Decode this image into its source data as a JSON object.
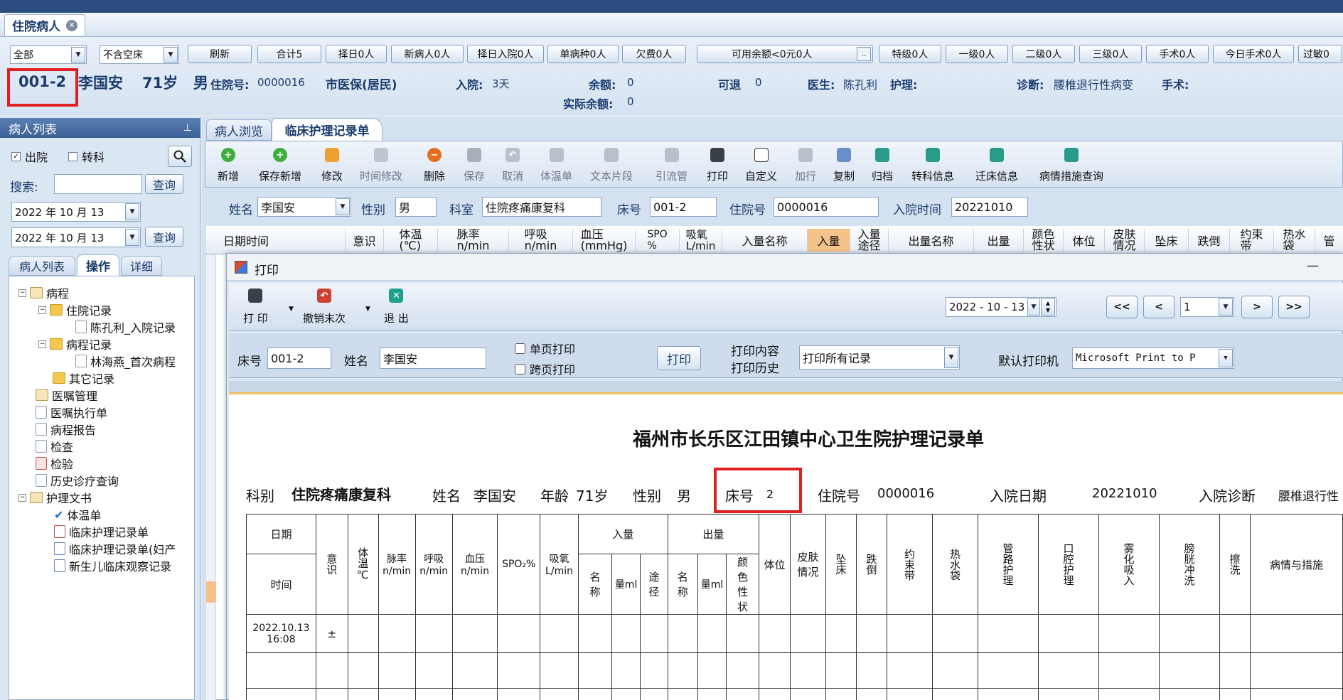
{
  "top_tab": {
    "label": "住院病人"
  },
  "filters": {
    "ward": "全部",
    "bed_filter": "不含空床"
  },
  "top_buttons": [
    "刷新",
    "合计5",
    "择日0人",
    "新病人0人",
    "择日入院0人",
    "单病种0人",
    "欠费0人",
    "可用余额<0元0人",
    "特级0人",
    "一级0人",
    "二级0人",
    "三级0人",
    "手术0人",
    "今日手术0人",
    "过敏0"
  ],
  "patient_bar": {
    "bed": "001-2",
    "name": "李国安",
    "age": "71岁",
    "sex": "男",
    "inpatient_label": "住院号:",
    "inpatient_no": "0000016",
    "insurance": "市医保(居民)",
    "admit_label": "入院:",
    "admit_days": "3天",
    "balance_label": "余额:",
    "balance": "0",
    "actual_balance_label": "实际余额:",
    "actual_balance": "0",
    "refund_label": "可退",
    "refund": "0",
    "doctor_label": "医生:",
    "doctor": "陈孔利",
    "nurse_label": "护理:",
    "diagnosis_label": "诊断:",
    "diagnosis": "腰椎退行性病变",
    "surgery_label": "手术:"
  },
  "left_panel": {
    "title": "病人列表",
    "discharged": "出院",
    "transfer": "转科",
    "search_label": "搜索:",
    "query": "查询",
    "date1": "2022 年 10 月 13",
    "date2": "2022 年 10 月 13",
    "tabs": [
      "病人列表",
      "操作",
      "详细"
    ],
    "tree": [
      "病程",
      "住院记录",
      "陈孔利_入院记录",
      "病程记录",
      "林海燕_首次病程",
      "其它记录",
      "医嘱管理",
      "医嘱执行单",
      "病程报告",
      "检查",
      "检验",
      "历史诊疗查询",
      "护理文书",
      "体温单",
      "临床护理记录单",
      "临床护理记录单(妇产",
      "新生儿临床观察记录"
    ]
  },
  "main_tabs": [
    "病人浏览",
    "临床护理记录单"
  ],
  "toolbar": [
    "新增",
    "保存新增",
    "修改",
    "时间修改",
    "删除",
    "保存",
    "取消",
    "体温单",
    "文本片段",
    "引流管",
    "打印",
    "自定义",
    "加行",
    "复制",
    "归档",
    "转科信息",
    "迁床信息",
    "病情措施查询"
  ],
  "form": {
    "name_label": "姓名",
    "name": "李国安",
    "sex_label": "性别",
    "sex": "男",
    "dept_label": "科室",
    "dept": "住院疼痛康复科",
    "bed_label": "床号",
    "bed": "001-2",
    "no_label": "住院号",
    "no": "0000016",
    "admit_label": "入院时间",
    "admit": "20221010"
  },
  "grid_headers": [
    "日期时间",
    "意识",
    "体温\n(℃)",
    "脉率\nn/min",
    "呼吸\nn/min",
    "血压\n(mmHg)",
    "SPO\n%",
    "吸氧\nL/min",
    "入量名称",
    "入量",
    "入量\n途径",
    "出量名称",
    "出量",
    "颜色\n性状",
    "体位",
    "皮肤\n情况",
    "坠床",
    "跌倒",
    "约束\n带",
    "热水\n袋",
    "管"
  ],
  "print_dialog": {
    "title": "打印",
    "print": "打 印",
    "undo": "撤销末次",
    "exit": "退 出",
    "date": "2022 - 10 - 13",
    "page": "1",
    "nav": [
      "<<",
      "<",
      ">",
      ">>"
    ],
    "bed_label": "床号",
    "bed": "001-2",
    "name_label": "姓名",
    "name": "李国安",
    "single_page": "单页打印",
    "cross_page": "跨页打印",
    "print_btn": "打印",
    "content_label": "打印内容",
    "history_label": "打印历史",
    "content": "打印所有记录",
    "printer_label": "默认打印机",
    "printer": "Microsoft Print to P",
    "minimize": "—"
  },
  "document": {
    "title": "福州市长乐区江田镇中心卫生院护理记录单",
    "dept_label": "科别",
    "dept": "住院疼痛康复科",
    "name_label": "姓名",
    "name": "李国安",
    "age_label": "年龄",
    "age": "71岁",
    "sex_label": "性别",
    "sex": "男",
    "bed_label": "床号",
    "bed": "2",
    "no_label": "住院号",
    "no": "0000016",
    "admit_label": "入院日期",
    "admit": "20221010",
    "diag_label": "入院诊断",
    "diag": "腰椎退行性",
    "headers": {
      "date": "日期",
      "time": "时间",
      "consc": "意识",
      "temp": "体温℃",
      "pulse": "脉率\nn/min",
      "resp": "呼吸\nn/min",
      "bp": "血压\nn/min",
      "spo": "SPO₂%",
      "oxy": "吸氧\nL/min",
      "intake": "入量",
      "output": "出量",
      "in_name": "名称",
      "in_amt": "量ml",
      "in_route": "途径",
      "out_name": "名称",
      "out_amt": "量ml",
      "out_color": "颜色性状",
      "position": "体位",
      "skin": "皮肤情况",
      "fall_bed": "坠床",
      "fall": "跌倒",
      "restraint": "约束带",
      "hotbag": "热水袋",
      "tube": "管路护理",
      "oral": "口腔护理",
      "atom": "雾化吸入",
      "bladder": "膀胱冲洗",
      "scrub": "擦洗",
      "measures": "病情与措施"
    },
    "rows": [
      {
        "datetime": "2022.10.13\n16:08",
        "consc": "±"
      }
    ]
  }
}
